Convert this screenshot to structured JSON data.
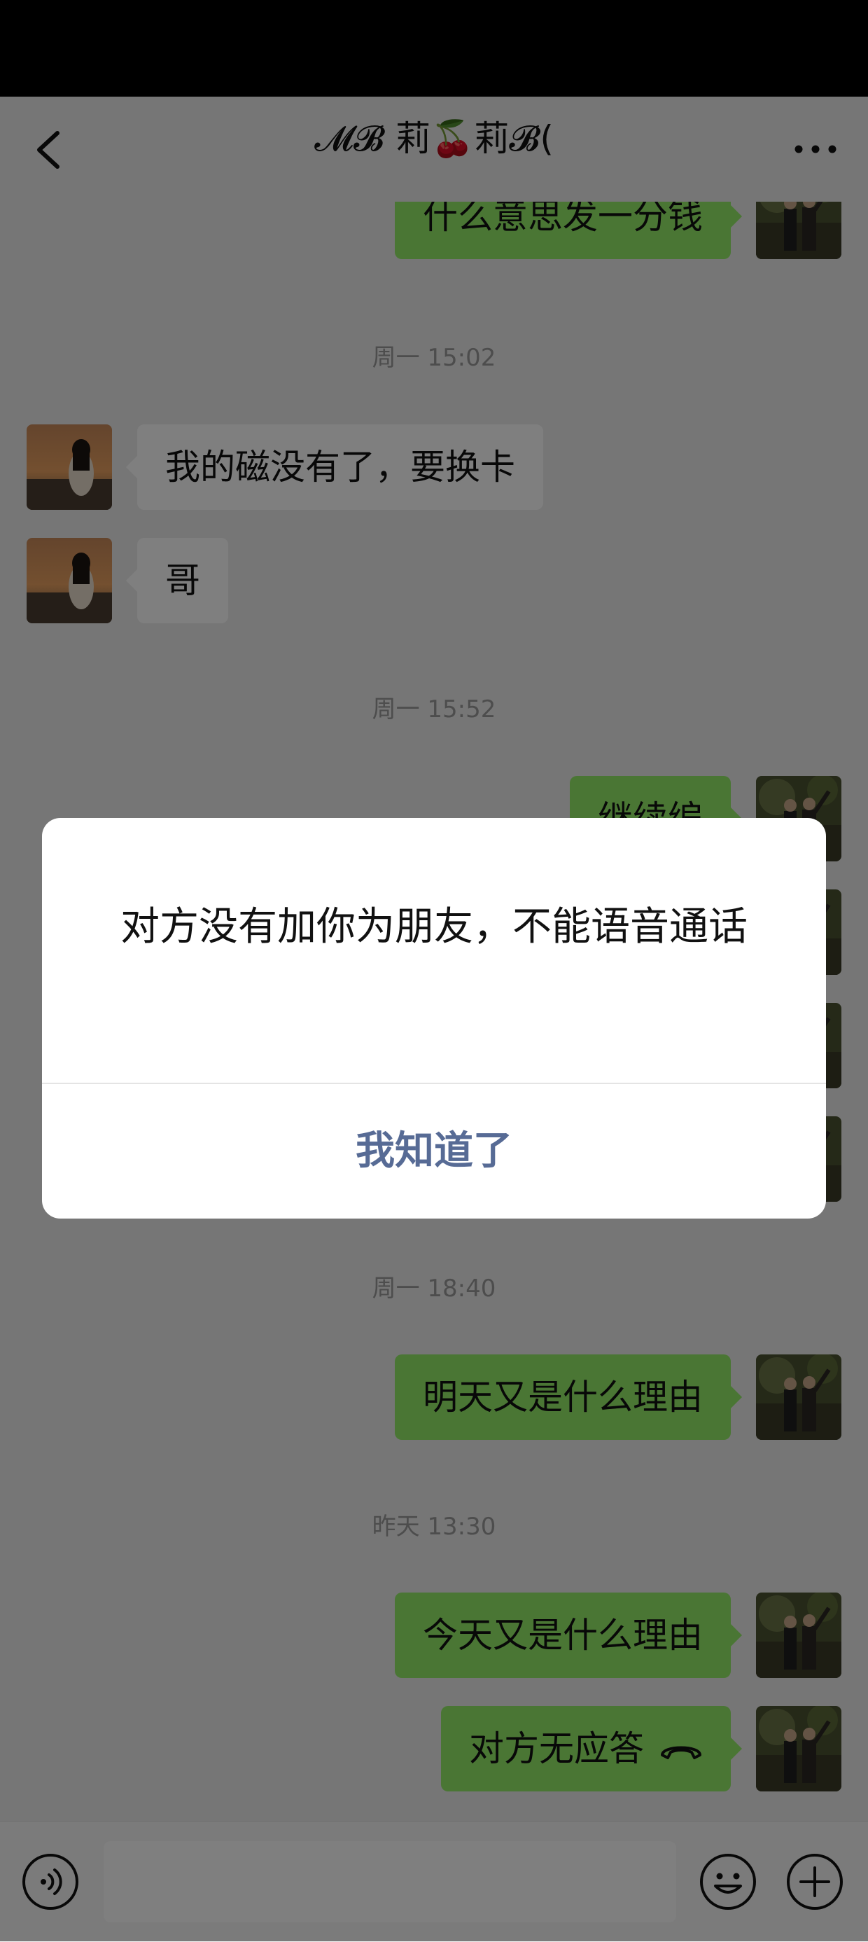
{
  "header": {
    "title": "𝓜𝓑 莉🍒莉𝓑("
  },
  "messages": [
    {
      "side": "me",
      "text": "什么意思发一分钱"
    },
    {
      "timestamp": "周一 15:02"
    },
    {
      "side": "friend",
      "text": "我的磁没有了，要换卡"
    },
    {
      "side": "friend",
      "text": "哥"
    },
    {
      "timestamp": "周一 15:52"
    },
    {
      "side": "me",
      "text": "继续编"
    },
    {
      "timestamp": "周一 18:40"
    },
    {
      "side": "me",
      "text": "明天又是什么理由"
    },
    {
      "timestamp": "昨天 13:30"
    },
    {
      "side": "me",
      "text": "今天又是什么理由"
    },
    {
      "side": "me",
      "text": "对方无应答",
      "icon": "hangup-icon"
    }
  ],
  "dialog": {
    "message": "对方没有加你为朋友，不能语音通话",
    "button_label": "我知道了"
  },
  "inputbar": {
    "value": "",
    "placeholder": ""
  },
  "colors": {
    "my_bubble": "#95ec69",
    "friend_bubble": "#ffffff",
    "dialog_button": "#576b95",
    "chat_background": "#ededed"
  }
}
